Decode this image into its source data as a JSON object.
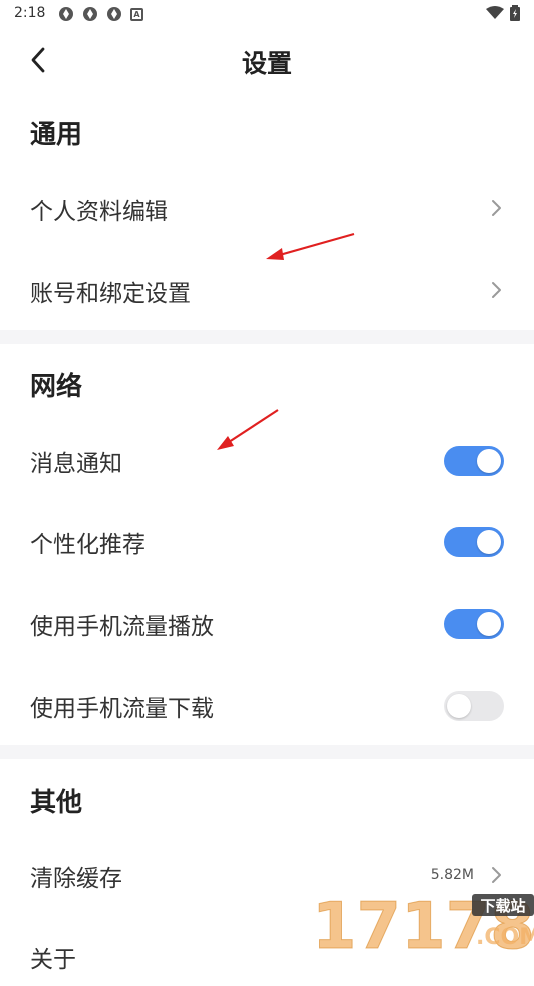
{
  "status_bar": {
    "time": "2:18",
    "badge_letter": "A"
  },
  "header": {
    "title": "设置"
  },
  "sections": {
    "general": {
      "title": "通用",
      "items": [
        {
          "label": "个人资料编辑"
        },
        {
          "label": "账号和绑定设置"
        }
      ]
    },
    "network": {
      "title": "网络",
      "items": [
        {
          "label": "消息通知",
          "enabled": true
        },
        {
          "label": "个性化推荐",
          "enabled": true
        },
        {
          "label": "使用手机流量播放",
          "enabled": true
        },
        {
          "label": "使用手机流量下载",
          "enabled": false
        }
      ]
    },
    "other": {
      "title": "其他",
      "items": [
        {
          "label": "清除缓存",
          "value": "5.82M"
        },
        {
          "label": "关于"
        }
      ]
    }
  },
  "watermark": {
    "text": "17178",
    "tag": "下载站",
    "domain": ".COM"
  },
  "colors": {
    "toggle_on": "#4a8df0",
    "toggle_off": "#e8e8ea",
    "annotation_arrow": "#e02020",
    "divider": "#f5f5f7"
  }
}
